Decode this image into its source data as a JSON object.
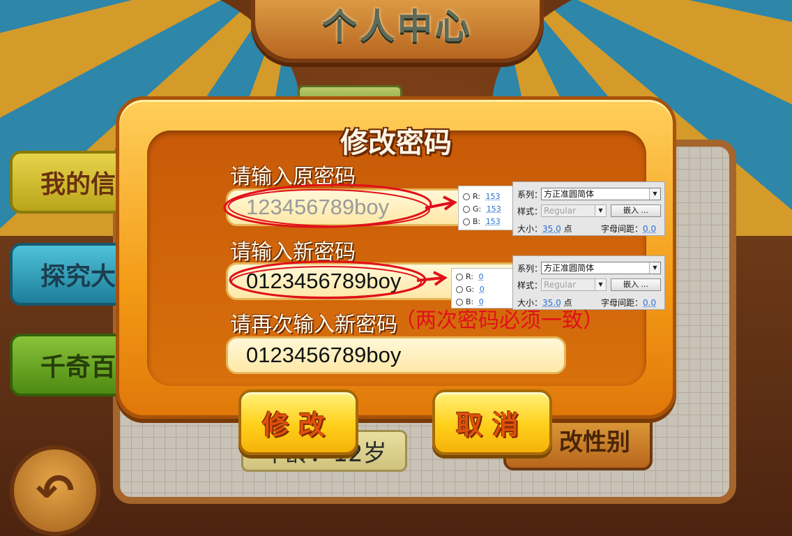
{
  "scene": {
    "title": "个人中心",
    "side_buttons": [
      "我的信",
      "探究大",
      "千奇百"
    ],
    "age_text": "年龄：12岁",
    "gender_button": "改性别",
    "back_icon": "↶"
  },
  "dialog": {
    "title": "修改密码",
    "old_password_label": "请输入原密码",
    "old_password_value": "123456789boy",
    "new_password_label": "请输入新密码",
    "new_password_value": "0123456789boy",
    "confirm_password_label": "请再次输入新密码",
    "confirm_password_value": "0123456789boy",
    "note": "（两次密码必须一致）",
    "modify_button": "修改",
    "cancel_button": "取消"
  },
  "font_specs": [
    {
      "rgb": {
        "r": "153",
        "g": "153",
        "b": "153"
      },
      "family_label": "系列：",
      "family": "方正准圆简体",
      "style_label": "样式：",
      "style": "Regular",
      "embed_button": "嵌入 ...",
      "size_label": "大小：",
      "size": "35.0",
      "size_unit": "点",
      "spacing_label": "字母间距：",
      "spacing": "0.0"
    },
    {
      "rgb": {
        "r": "0",
        "g": "0",
        "b": "0"
      },
      "family_label": "系列：",
      "family": "方正准圆简体",
      "style_label": "样式：",
      "style": "Regular",
      "embed_button": "嵌入 ...",
      "size_label": "大小：",
      "size": "35.0",
      "size_unit": "点",
      "spacing_label": "字母间距：",
      "spacing": "0.0"
    }
  ],
  "colors": {
    "annotation_red": "#e0101a",
    "placeholder_gray": "#999999",
    "dialog_orange": "#f39a16"
  }
}
